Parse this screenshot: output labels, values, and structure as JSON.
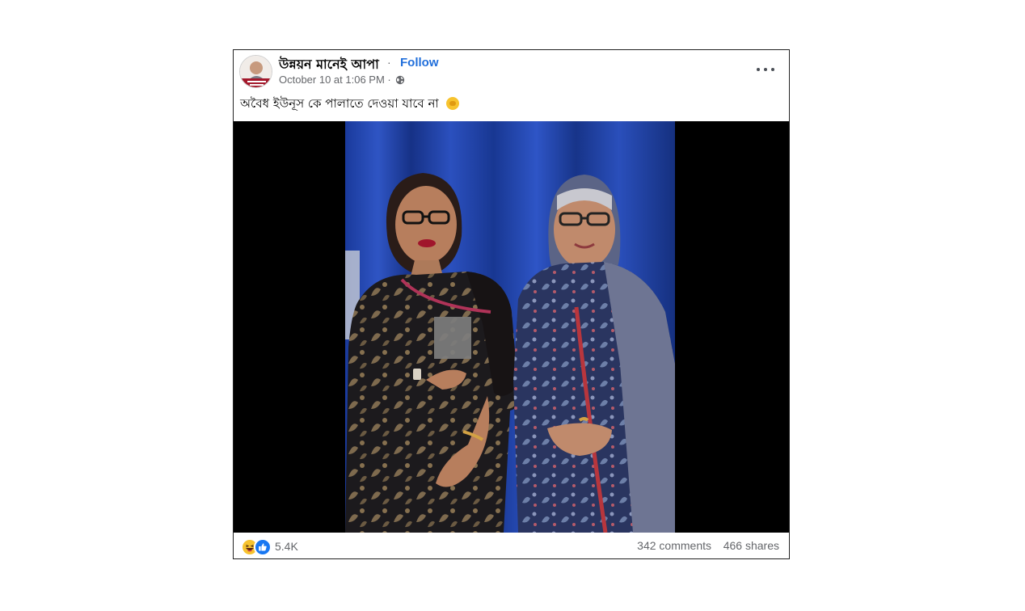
{
  "post": {
    "page_name": "উন্নয়ন মানেই আপা",
    "separator": "·",
    "follow_label": "Follow",
    "timestamp": "October 10 at 1:06 PM",
    "meta_separator": "·",
    "privacy_icon": "globe-icon",
    "more_icon": "more-options-icon",
    "caption": "অবৈধ ইউনূস কে পালাতে দেওয়া যাবে না",
    "caption_emoji": "raised-fist-emoji",
    "photo_icon": "photo-of-two-women-in-sarees"
  },
  "footer": {
    "reaction_icons": [
      "haha-reaction-icon",
      "like-reaction-icon"
    ],
    "reaction_count": "5.4K",
    "comments": "342 comments",
    "shares": "466 shares"
  },
  "colors": {
    "follow": "#216fdb",
    "meta_text": "#65676b",
    "like_blue": "#1877f2",
    "haha_yellow": "#f7c32e",
    "curtain_blue": "#1c3fa6"
  }
}
